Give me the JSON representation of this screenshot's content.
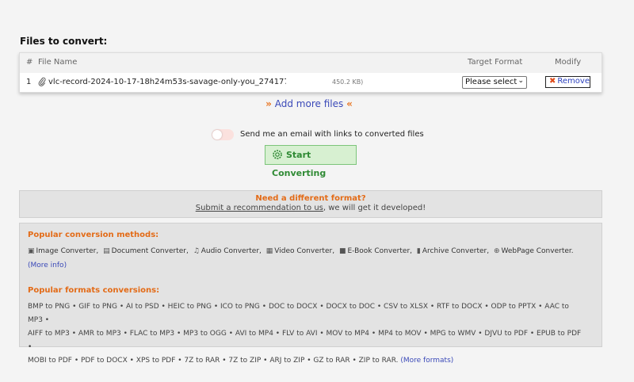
{
  "files_title": "Files to convert:",
  "table": {
    "headers": {
      "num": "#",
      "file_name": "File Name",
      "target_format": "Target Format",
      "modify": "Modify"
    },
    "row": {
      "num": "1",
      "file_name": "vlc-record-2024-10-17-18h24m53s-savage-only-you_274177",
      "file_size": "450.2 KB)",
      "target_format_selected": "Please select",
      "remove_label": "Remove"
    }
  },
  "add_more": "Add more files",
  "email_label": "Send me an email with links to converted files",
  "start_label": "Start Converting",
  "need_format": {
    "title": "Need a different format?",
    "link": "Submit a recommendation to us",
    "rest": ", we will get it developed!"
  },
  "popular": {
    "methods_title": "Popular conversion methods:",
    "methods": [
      {
        "icon": "image-icon",
        "label": "Image Converter,"
      },
      {
        "icon": "document-icon",
        "label": "Document Converter,"
      },
      {
        "icon": "music-note-icon",
        "label": "Audio Converter,"
      },
      {
        "icon": "film-icon",
        "label": "Video Converter,"
      },
      {
        "icon": "book-icon",
        "label": "E-Book Converter,"
      },
      {
        "icon": "archive-icon",
        "label": "Archive Converter,"
      },
      {
        "icon": "globe-icon",
        "label": "WebPage Converter."
      }
    ],
    "more_info": "(More info)",
    "formats_title": "Popular formats conversions:",
    "format_lines": [
      "BMP to PNG • GIF to PNG • AI to PSD • HEIC to PNG • ICO to PNG • DOC to DOCX • DOCX to DOC • CSV to XLSX • RTF to DOCX • ODP to PPTX • AAC to MP3 •",
      "AIFF to MP3 • AMR to MP3 • FLAC to MP3 • MP3 to OGG • AVI to MP4 • FLV to AVI • MOV to MP4 • MP4 to MOV • MPG to WMV • DJVU to PDF • EPUB to PDF •",
      "MOBI to PDF • PDF to DOCX • XPS to PDF • 7Z to RAR • 7Z to ZIP • ARJ to ZIP • GZ to RAR • ZIP to RAR."
    ],
    "more_formats": "(More formats)"
  },
  "colors": {
    "accent_orange": "#e36b17",
    "link_blue": "#3a49b8",
    "start_green": "#2f8a34"
  }
}
